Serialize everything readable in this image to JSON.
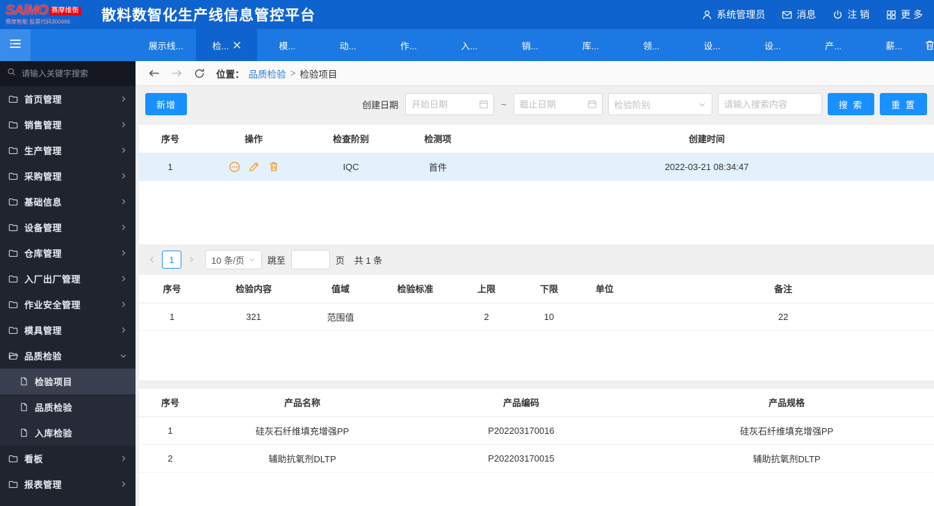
{
  "header": {
    "logo_main": "SAiMO",
    "logo_badge": "赛摩维衡",
    "logo_caption": "赛摩智能 股票代码300466",
    "title": "散料数智化生产线信息管控平台",
    "user_label": "系统管理员",
    "messages_label": "消息",
    "logout_label": "注 销",
    "more_label": "更 多"
  },
  "tabs": {
    "items": [
      "展示线...",
      "检...",
      "模...",
      "动...",
      "作...",
      "入...",
      "销...",
      "库...",
      "领...",
      "设...",
      "设...",
      "产...",
      "薪..."
    ]
  },
  "sidebar": {
    "search_placeholder": "请输入关键字搜索",
    "items": [
      {
        "label": "首页管理"
      },
      {
        "label": "销售管理"
      },
      {
        "label": "生产管理"
      },
      {
        "label": "采购管理"
      },
      {
        "label": "基础信息"
      },
      {
        "label": "设备管理"
      },
      {
        "label": "仓库管理"
      },
      {
        "label": "入厂出厂管理"
      },
      {
        "label": "作业安全管理"
      },
      {
        "label": "模具管理"
      },
      {
        "label": "品质检验"
      },
      {
        "label": "看板"
      },
      {
        "label": "报表管理"
      }
    ],
    "submenu": [
      {
        "label": "检验项目"
      },
      {
        "label": "品质检验"
      },
      {
        "label": "入库检验"
      }
    ]
  },
  "breadcrumb": {
    "location_label": "位置：",
    "parent": "品质检验",
    "separator": ">",
    "current": "检验项目"
  },
  "toolbar": {
    "add_label": "新增",
    "create_date_label": "创建日期",
    "start_date_placeholder": "开始日期",
    "tilde": "~",
    "end_date_placeholder": "截止日期",
    "stage_placeholder": "检验阶别",
    "keyword_placeholder": "请输入搜索内容",
    "search_label": "搜 索",
    "reset_label": "重 置",
    "accent_color": "#1890ff"
  },
  "table1": {
    "headers": [
      "序号",
      "操作",
      "检查阶别",
      "检测项",
      "创建时间"
    ],
    "row": {
      "index": "1",
      "stage": "IQC",
      "item": "首件",
      "created": "2022-03-21 08:34:47"
    }
  },
  "pagination": {
    "current_page": "1",
    "page_size": "10 条/页",
    "jump_label": "跳至",
    "jump_value": "",
    "page_unit": "页",
    "total_text": "共 1 条"
  },
  "table2": {
    "headers": [
      "序号",
      "检验内容",
      "值域",
      "检验标准",
      "上限",
      "下限",
      "单位",
      "备注"
    ],
    "rows": [
      [
        "1",
        "321",
        "范围值",
        "",
        "2",
        "10",
        "",
        "22"
      ]
    ]
  },
  "table3": {
    "headers": [
      "序号",
      "产品名称",
      "产品编码",
      "产品规格"
    ],
    "rows": [
      [
        "1",
        "硅灰石纤维填充增强PP",
        "P202203170016",
        "硅灰石纤维填充增强PP"
      ],
      [
        "2",
        "辅助抗氧剂DLTP",
        "P202203170015",
        "辅助抗氧剂DLTP"
      ]
    ]
  },
  "icons": {
    "operation_color": "#f59a23",
    "selected_row_color": "#e3f1fd"
  }
}
